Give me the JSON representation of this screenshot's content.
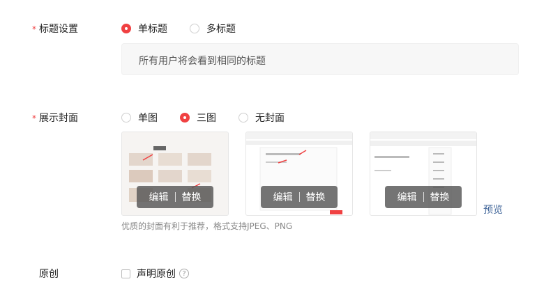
{
  "title_setting": {
    "required_mark": "*",
    "label": "标题设置",
    "options": [
      "单标题",
      "多标题"
    ],
    "selected": "单标题",
    "info": "所有用户将会看到相同的标题"
  },
  "cover_setting": {
    "required_mark": "*",
    "label": "展示封面",
    "options": [
      "单图",
      "三图",
      "无封面"
    ],
    "selected": "三图",
    "covers": [
      {
        "edit": "编辑",
        "replace": "替换"
      },
      {
        "edit": "编辑",
        "replace": "替换"
      },
      {
        "edit": "编辑",
        "replace": "替换"
      }
    ],
    "preview": "预览",
    "hint": "优质的封面有利于推荐，格式支持JPEG、PNG"
  },
  "original": {
    "label": "原创",
    "checkbox_label": "声明原创",
    "checked": false,
    "help_icon": "question-circle-icon",
    "help_glyph": "?"
  },
  "colors": {
    "accent": "#f04142",
    "link": "#406599"
  }
}
